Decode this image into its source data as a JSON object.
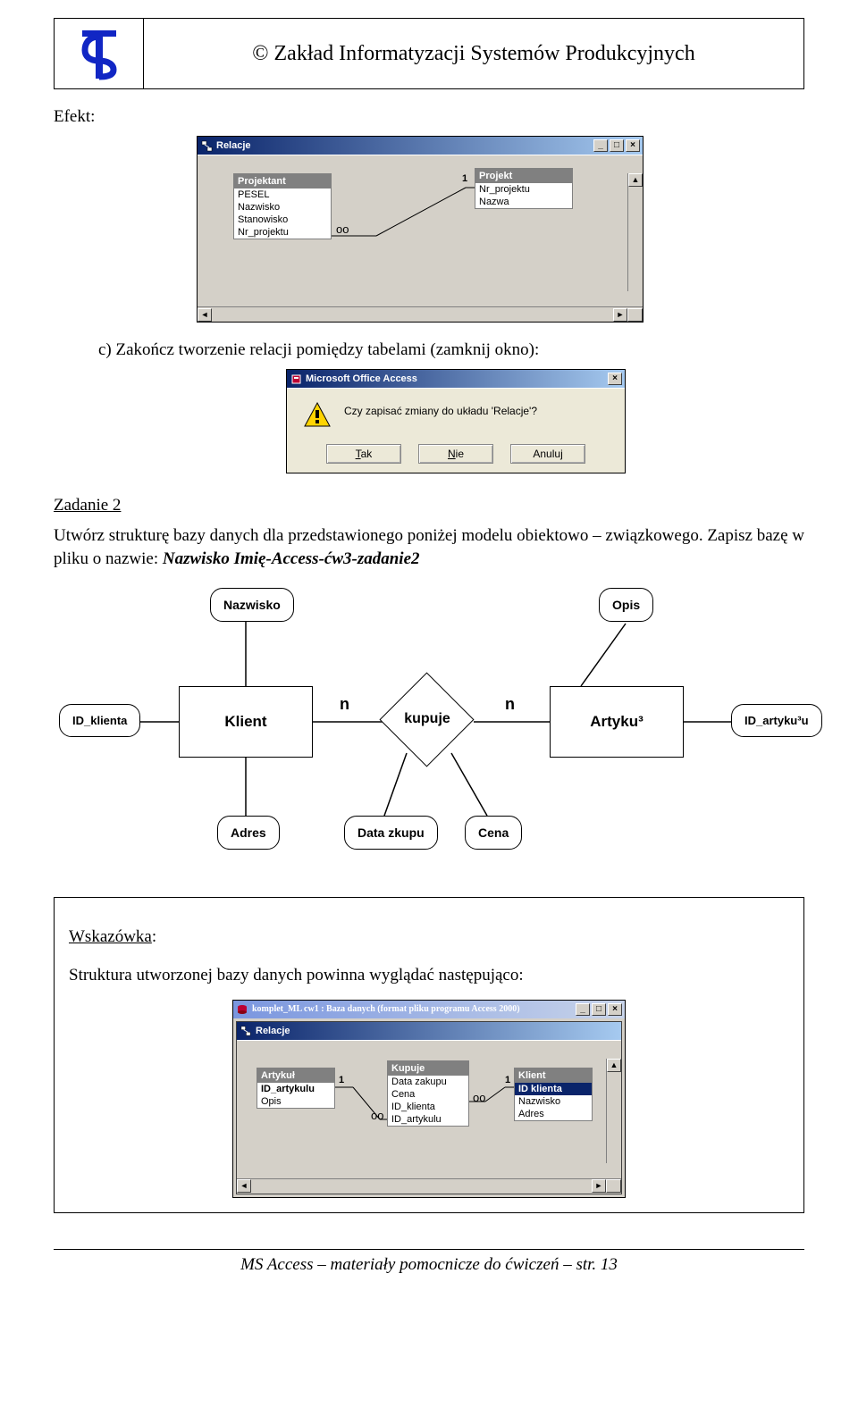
{
  "header": {
    "copyright": "© Zakład Informatyzacji Systemów Produkcyjnych"
  },
  "labels": {
    "efekt": "Efekt:",
    "task_c": "c)   Zakończ tworzenie relacji pomiędzy tabelami (zamknij okno):",
    "zadanie2": "Zadanie 2",
    "zadanie2_text": "Utwórz strukturę bazy danych dla przedstawionego poniżej modelu obiektowo – związkowego. Zapisz bazę w pliku o nazwie: ",
    "filename": "Nazwisko Imię-Access-ćw3-zadanie2",
    "hint_label": "Wskazówka",
    "hint_text": "Struktura utworzonej bazy danych powinna wyglądać następująco:"
  },
  "relacje_window": {
    "title": "Relacje",
    "tables": {
      "projektant": {
        "name": "Projektant",
        "fields": [
          "PESEL",
          "Nazwisko",
          "Stanowisko",
          "Nr_projektu"
        ]
      },
      "projekt": {
        "name": "Projekt",
        "fields": [
          "Nr_projektu",
          "Nazwa"
        ]
      }
    },
    "rel_labels": {
      "one": "1",
      "many": "oo"
    }
  },
  "dialog": {
    "title": "Microsoft Office Access",
    "message": "Czy zapisać zmiany do układu 'Relacje'?",
    "btn_yes": "Tak",
    "btn_no": "Nie",
    "btn_cancel": "Anuluj"
  },
  "er": {
    "attrs": {
      "nazwisko": "Nazwisko",
      "opis": "Opis",
      "id_klienta": "ID_klienta",
      "id_artykulu": "ID_artyku³u",
      "adres": "Adres",
      "data_zkupu": "Data zkupu",
      "cena": "Cena"
    },
    "entities": {
      "klient": "Klient",
      "artykul": "Artyku³"
    },
    "rel": "kupuje",
    "n": "n"
  },
  "relacje2": {
    "back_title": "komplet_ML cw1 : Baza danych (format pliku programu Access 2000)",
    "title": "Relacje",
    "tables": {
      "artykul": {
        "name": "Artykuł",
        "fields": [
          "ID_artykulu",
          "Opis"
        ]
      },
      "kupuje": {
        "name": "Kupuje",
        "fields": [
          "Data zakupu",
          "Cena",
          "ID_klienta",
          "ID_artykulu"
        ]
      },
      "klient": {
        "name": "Klient",
        "fields": [
          "ID klienta",
          "Nazwisko",
          "Adres"
        ]
      }
    },
    "rel_labels": {
      "one": "1",
      "many": "oo"
    }
  },
  "footer": {
    "text_prefix": "MS Access",
    "text_rest": " – materiały pomocnicze do ćwiczeń – str. 13"
  },
  "icons": {
    "min": "_",
    "max": "□",
    "close": "×",
    "left": "◄",
    "right": "►",
    "up": "▲",
    "down": "▼"
  }
}
